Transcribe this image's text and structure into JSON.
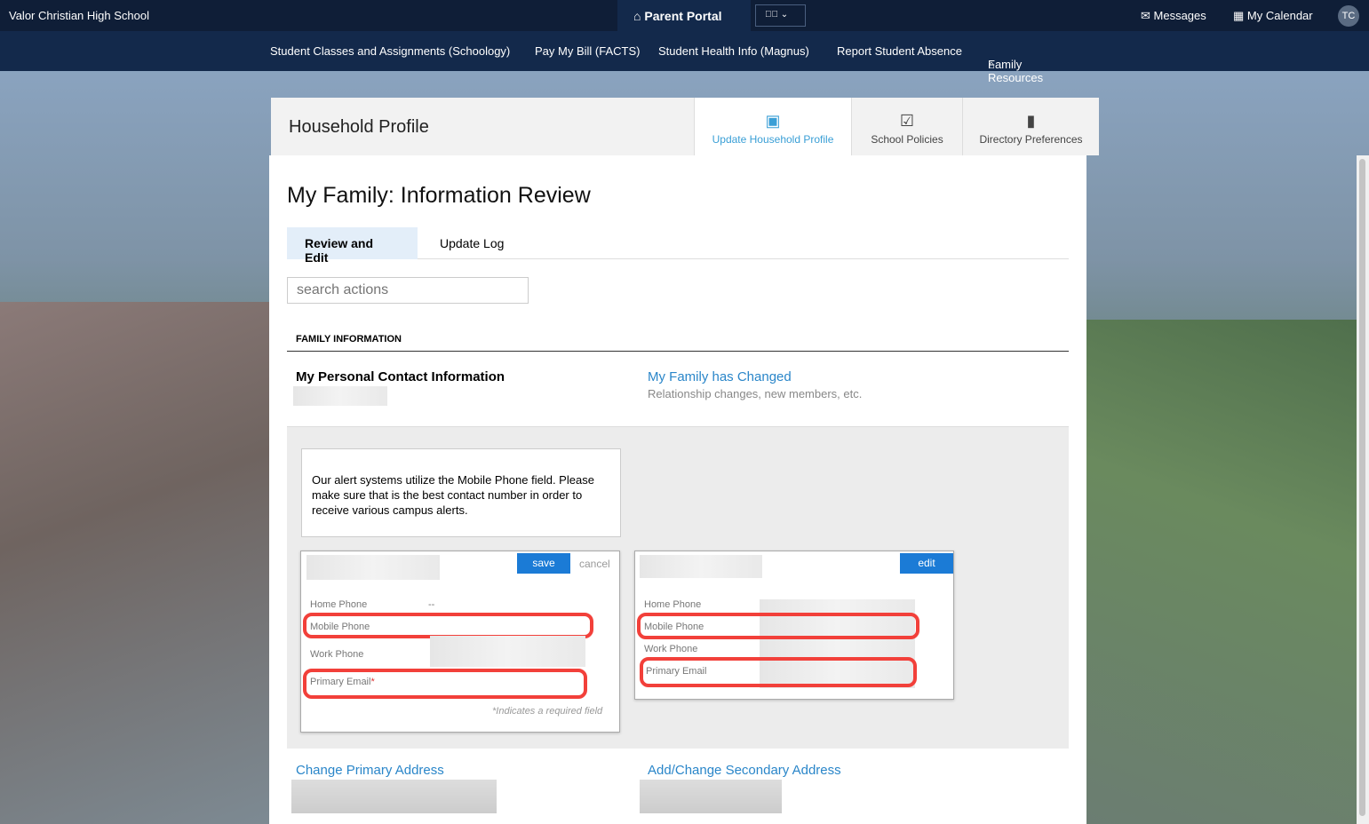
{
  "topbar": {
    "school": "Valor Christian High School",
    "portal": "Parent Portal",
    "messages": "Messages",
    "calendar": "My Calendar",
    "avatar": "TC"
  },
  "nav": [
    "Student Classes and Assignments (Schoology)",
    "Pay My Bill (FACTS)",
    "Student Health Info (Magnus)",
    "Report Student Absence",
    "Family Resources"
  ],
  "header": {
    "title": "Household Profile",
    "tabs": [
      "Update Household Profile",
      "School Policies",
      "Directory Preferences"
    ]
  },
  "page": {
    "title": "My Family: Information Review",
    "subtabs": [
      "Review and Edit",
      "Update Log"
    ],
    "search_placeholder": "search actions",
    "section": "FAMILY INFORMATION",
    "personal": "My Personal Contact Information",
    "changed": "My Family has Changed",
    "changed_desc": "Relationship changes, new members, etc.",
    "alert": "Our alert systems utilize the Mobile Phone field. Please make sure that is the best contact number in order to receive various campus alerts.",
    "edit_card": {
      "save": "save",
      "cancel": "cancel",
      "home": "Home Phone",
      "home_val": "--",
      "mobile": "Mobile Phone",
      "work": "Work Phone",
      "email": "Primary Email",
      "req": "*",
      "note": "*Indicates a required field"
    },
    "view_card": {
      "edit": "edit",
      "home": "Home Phone",
      "mobile": "Mobile Phone",
      "work": "Work Phone",
      "email": "Primary Email"
    },
    "primary_address": "Change Primary Address",
    "secondary_address": "Add/Change Secondary Address"
  }
}
